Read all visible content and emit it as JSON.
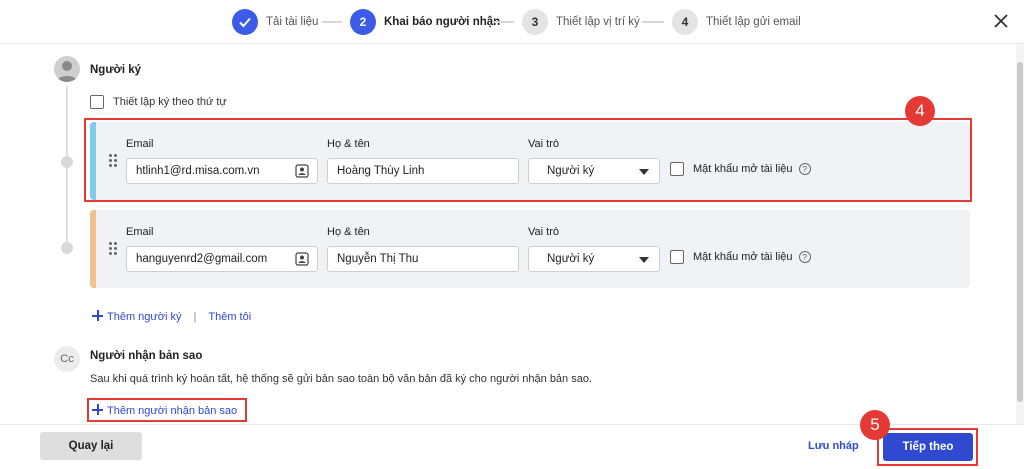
{
  "stepper": {
    "steps": [
      {
        "number": "✓",
        "label": "Tải tài liệu",
        "state": "done"
      },
      {
        "number": "2",
        "label": "Khai báo người nhận",
        "state": "active"
      },
      {
        "number": "3",
        "label": "Thiết lập vị trí ký",
        "state": "pending"
      },
      {
        "number": "4",
        "label": "Thiết lập gửi email",
        "state": "pending"
      }
    ]
  },
  "signers_section": {
    "title": "Người ký",
    "order_label": "Thiết lập ký theo thứ tự",
    "order_checked": false,
    "signers": [
      {
        "email_label": "Email",
        "email": "htlinh1@rd.misa.com.vn",
        "name_label": "Họ & tên",
        "name": "Hoàng Thùy Linh",
        "role_label": "Vai trò",
        "role": "Người ký",
        "password_label": "Mật khẩu mở tài liệu",
        "password_checked": false,
        "accent_color": "#7ecbea"
      },
      {
        "email_label": "Email",
        "email": "hanguyenrd2@gmail.com",
        "name_label": "Họ & tên",
        "name": "Nguyễn Thị Thu",
        "role_label": "Vai trò",
        "role": "Người ký",
        "password_label": "Mật khẩu mở tài liệu",
        "password_checked": false,
        "accent_color": "#f2c28a"
      }
    ],
    "add_signer": "Thêm người ký",
    "separator": "|",
    "add_me": "Thêm tôi"
  },
  "cc_section": {
    "avatar_text": "Cc",
    "title": "Người nhận bản sao",
    "description": "Sau khi quá trình ký hoàn tất, hệ thống sẽ gửi bản sao toàn bộ văn bản đã ký cho người nhận bản sao.",
    "add_cc": "Thêm người nhận bản sao"
  },
  "annotations": {
    "badge_4": "4",
    "badge_5": "5",
    "color": "#e53935"
  },
  "footer": {
    "back": "Quay lại",
    "save_draft": "Lưu nháp",
    "next": "Tiếp theo"
  },
  "colors": {
    "primary": "#3b5be8",
    "link": "#2f49d1"
  }
}
